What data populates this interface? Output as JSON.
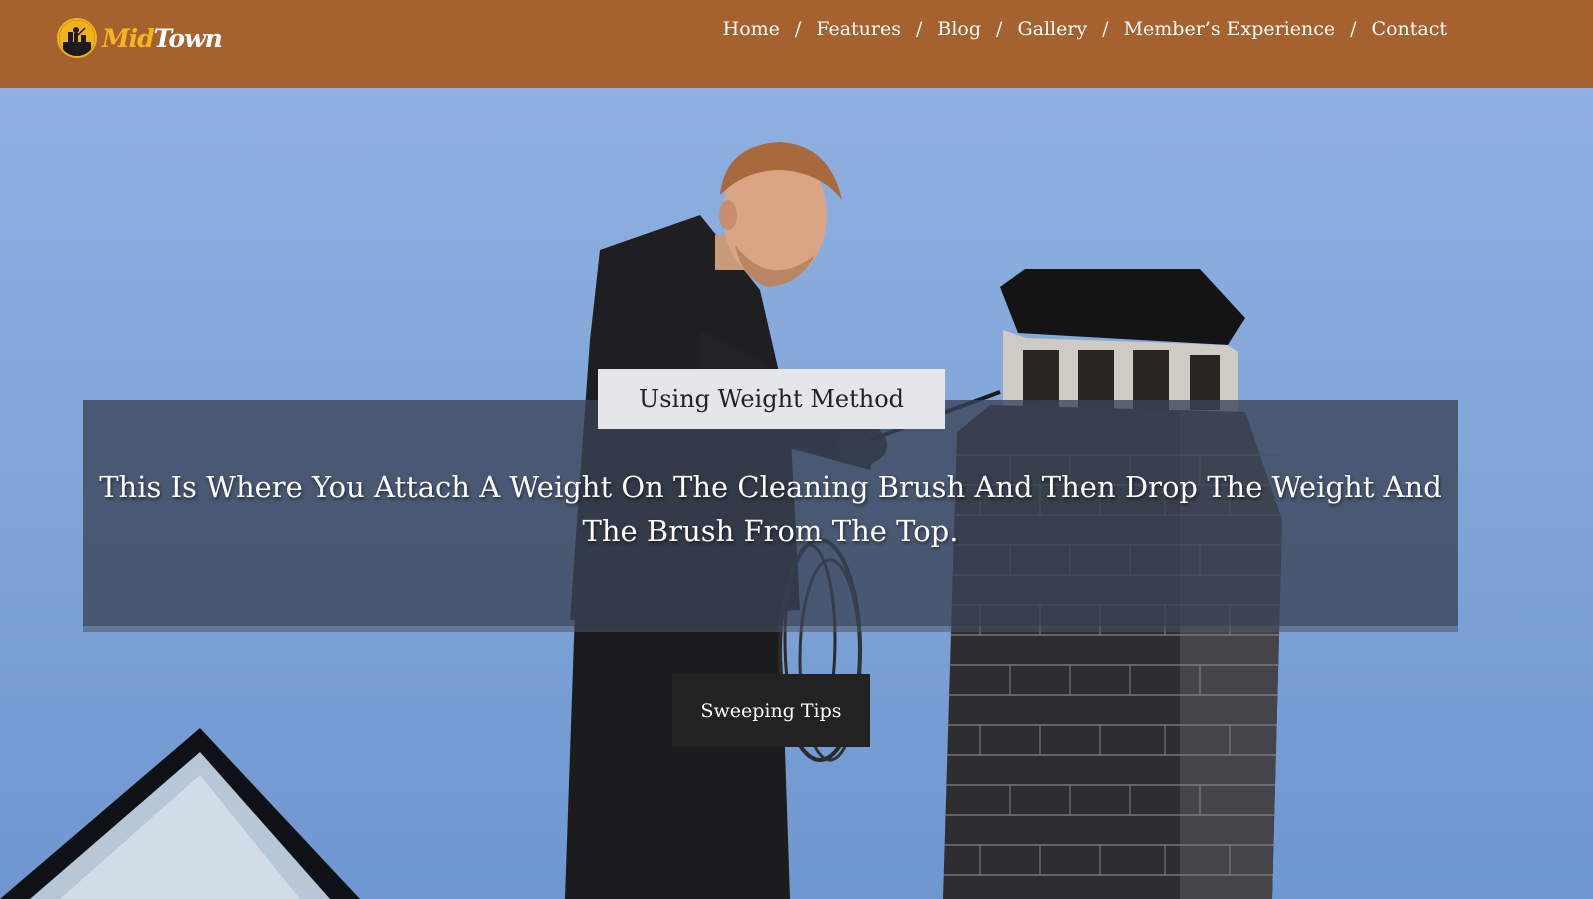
{
  "header": {
    "logo": {
      "part1": "Mid",
      "part2": "Town",
      "icon": "chimney-sweep-logo-icon"
    },
    "nav": [
      {
        "label": "Home"
      },
      {
        "label": "Features"
      },
      {
        "label": "Blog"
      },
      {
        "label": "Gallery"
      },
      {
        "label": "Member’s Experience"
      },
      {
        "label": "Contact"
      }
    ],
    "separator": "/"
  },
  "hero": {
    "image": "chimney-sweep-on-roof-photo",
    "tag": "Using Weight Method",
    "text": "This Is Where You Attach A Weight On The Cleaning Brush And Then Drop The Weight And The Brush From The Top.",
    "button": "Sweeping Tips"
  },
  "colors": {
    "header_bg": "#a5612e",
    "logo_accent": "#f5b61d",
    "sky": "#81a6da",
    "panel_bg": "#3a4256",
    "tag_bg": "#e4e6ea",
    "button_bg": "#222222"
  }
}
